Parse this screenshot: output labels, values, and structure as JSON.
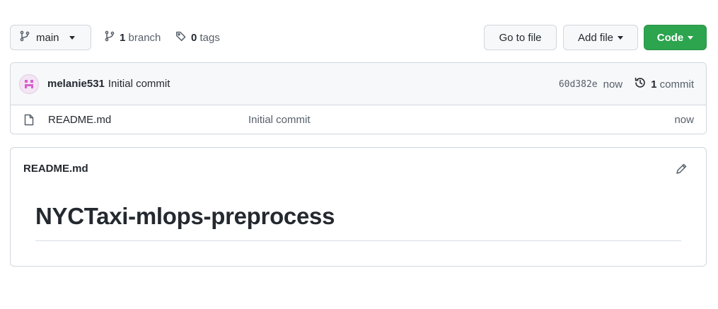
{
  "toolbar": {
    "branch": "main",
    "branch_count": "1",
    "branch_word": "branch",
    "tag_count": "0",
    "tag_word": "tags",
    "goto_file": "Go to file",
    "add_file": "Add file",
    "code": "Code",
    "code_color": "#2da44e"
  },
  "latest_commit": {
    "author": "melanie531",
    "message": "Initial commit",
    "sha": "60d382e",
    "age": "now",
    "commit_count": "1",
    "commit_word": "commit"
  },
  "files": [
    {
      "name": "README.md",
      "message": "Initial commit",
      "age": "now",
      "icon": "file-icon"
    }
  ],
  "readme": {
    "title": "README.md",
    "heading": "NYCTaxi-mlops-preprocess"
  },
  "icons": {
    "branch": "git-branch-icon",
    "tag": "tag-icon",
    "history": "history-icon",
    "edit": "pencil-icon"
  }
}
